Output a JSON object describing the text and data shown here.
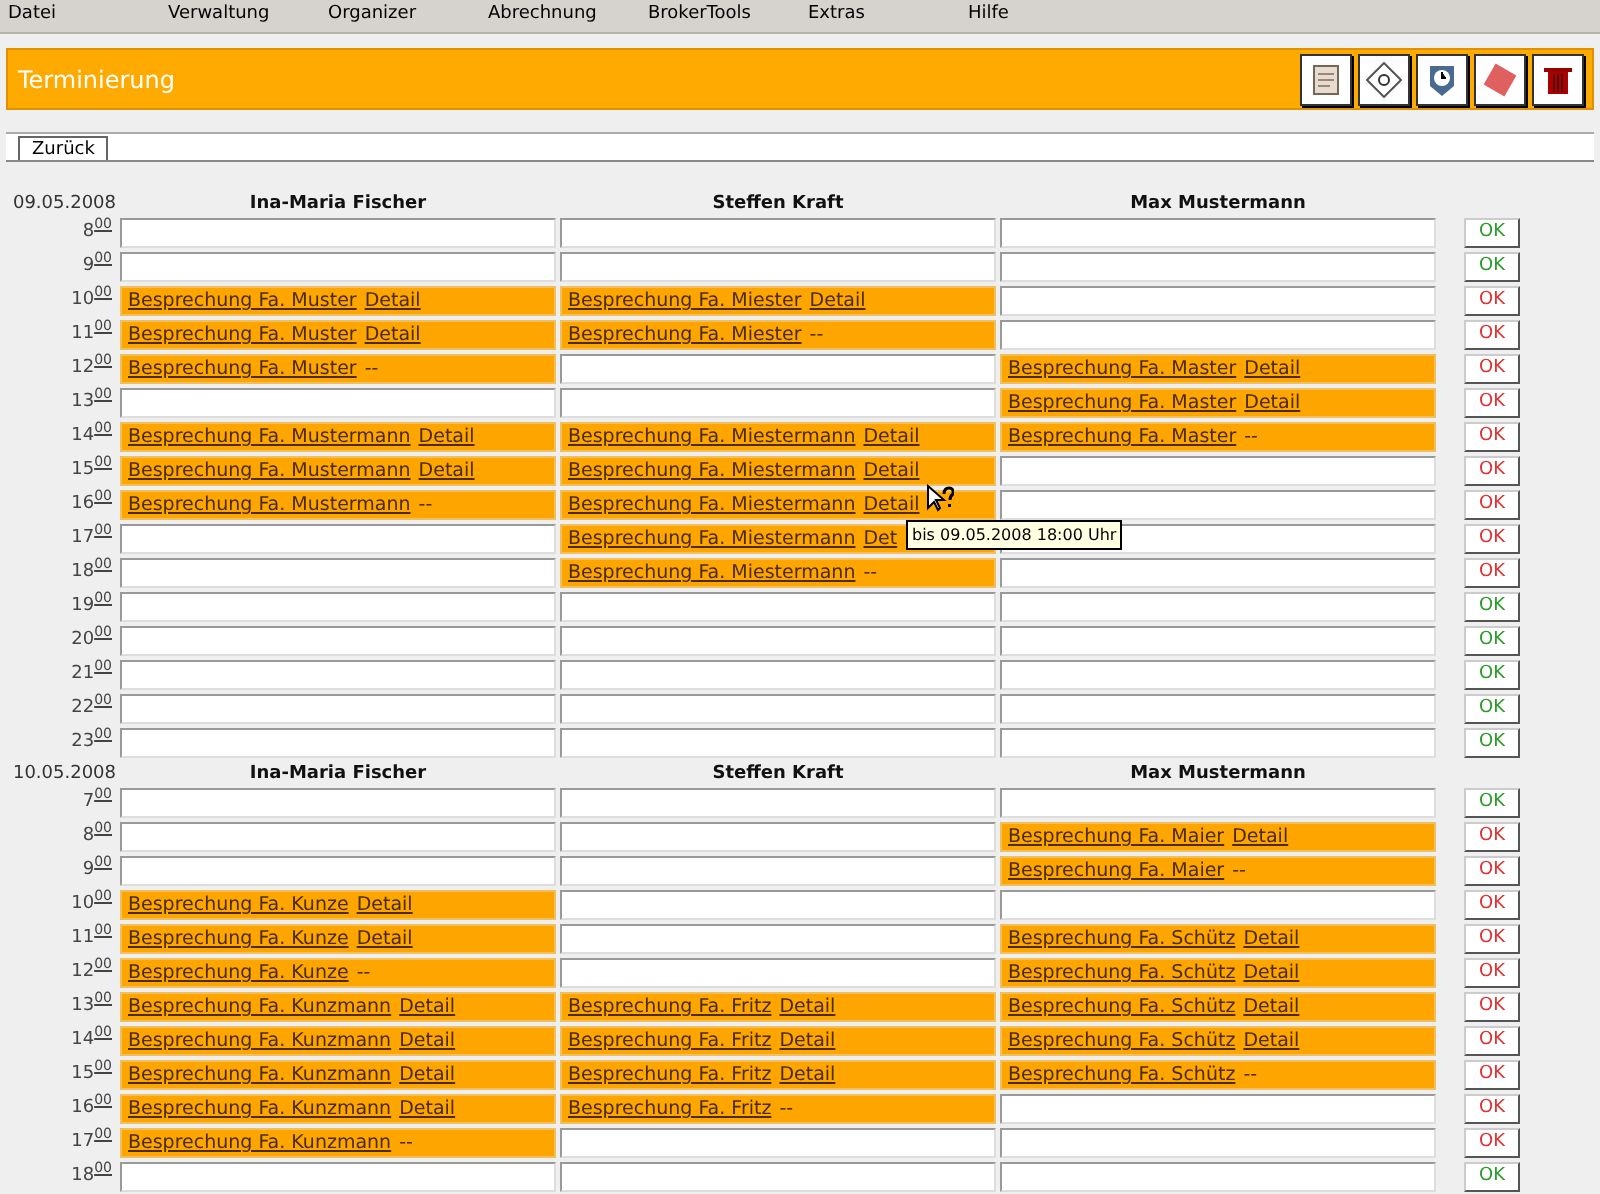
{
  "menu": [
    "Datei",
    "Verwaltung",
    "Organizer",
    "Abrechnung",
    "BrokerTools",
    "Extras",
    "Hilfe"
  ],
  "header": {
    "title": "Terminierung"
  },
  "tabs": [
    {
      "label": "Zurück",
      "selected": true
    }
  ],
  "days": [
    {
      "date": "09.05.2008",
      "people": [
        "Ina-Maria Fischer",
        "Steffen Kraft",
        "Max Mustermann"
      ],
      "rows": [
        {
          "hour": "8$^{00}$",
          "busy": false,
          "button": "OK",
          "slots": [
            {
              "kind": "free"
            },
            {
              "kind": "free"
            },
            {
              "kind": "free"
            }
          ]
        },
        {
          "hour": "9$^{00}$",
          "busy": false,
          "button": "OK",
          "slots": [
            {
              "kind": "free"
            },
            {
              "kind": "free"
            },
            {
              "kind": "free"
            }
          ]
        },
        {
          "hour": "10$^{00}$",
          "busy": true,
          "button": "OK",
          "slots": [
            {
              "kind": "appointment",
              "subject": "Besprechung Fa. Muster",
              "action": "Detail"
            },
            {
              "kind": "appointment",
              "subject": "Besprechung Fa. Miester",
              "action": "Detail"
            },
            {
              "kind": "free"
            }
          ]
        },
        {
          "hour": "11$^{00}$",
          "busy": true,
          "button": "OK",
          "slots": [
            {
              "kind": "appointment",
              "subject": "Besprechung Fa. Muster",
              "action": "Detail"
            },
            {
              "kind": "appointment",
              "subject": "Besprechung Fa. Miester",
              "action": "--"
            },
            {
              "kind": "free"
            }
          ]
        },
        {
          "hour": "12$^{00}$",
          "busy": true,
          "button": "OK",
          "slots": [
            {
              "kind": "appointment",
              "subject": "Besprechung Fa. Muster",
              "action": "--"
            },
            {
              "kind": "free"
            },
            {
              "kind": "appointment",
              "subject": "Besprechung Fa. Master",
              "action": "Detail"
            }
          ]
        },
        {
          "hour": "13$^{00}$",
          "busy": true,
          "button": "OK",
          "slots": [
            {
              "kind": "free"
            },
            {
              "kind": "free"
            },
            {
              "kind": "appointment",
              "subject": "Besprechung Fa. Master",
              "action": "Detail"
            }
          ]
        },
        {
          "hour": "14$^{00}$",
          "busy": true,
          "button": "OK",
          "slots": [
            {
              "kind": "appointment",
              "subject": "Besprechung Fa. Mustermann",
              "action": "Detail"
            },
            {
              "kind": "appointment",
              "subject": "Besprechung Fa. Miestermann",
              "action": "Detail"
            },
            {
              "kind": "appointment",
              "subject": "Besprechung Fa. Master",
              "action": "--"
            }
          ]
        },
        {
          "hour": "15$^{00}$",
          "busy": true,
          "button": "OK",
          "slots": [
            {
              "kind": "appointment",
              "subject": "Besprechung Fa. Mustermann",
              "action": "Detail"
            },
            {
              "kind": "appointment",
              "subject": "Besprechung Fa. Miestermann",
              "action": "Detail"
            },
            {
              "kind": "free"
            }
          ]
        },
        {
          "hour": "16$^{00}$",
          "busy": true,
          "button": "OK",
          "slots": [
            {
              "kind": "appointment",
              "subject": "Besprechung Fa. Mustermann",
              "action": "--"
            },
            {
              "kind": "appointment",
              "subject": "Besprechung Fa. Miestermann",
              "action": "Detail"
            },
            {
              "kind": "free"
            }
          ]
        },
        {
          "hour": "17$^{00}$",
          "busy": true,
          "button": "OK",
          "slots": [
            {
              "kind": "free"
            },
            {
              "kind": "appointment",
              "subject": "Besprechung Fa. Miestermann",
              "action": "Det"
            },
            {
              "kind": "free"
            }
          ]
        },
        {
          "hour": "18$^{00}$",
          "busy": true,
          "button": "OK",
          "slots": [
            {
              "kind": "free"
            },
            {
              "kind": "appointment",
              "subject": "Besprechung Fa. Miestermann",
              "action": "--"
            },
            {
              "kind": "free"
            }
          ]
        },
        {
          "hour": "19$^{00}$",
          "busy": false,
          "button": "OK",
          "slots": [
            {
              "kind": "free"
            },
            {
              "kind": "free"
            },
            {
              "kind": "free"
            }
          ]
        },
        {
          "hour": "20$^{00}$",
          "busy": false,
          "button": "OK",
          "slots": [
            {
              "kind": "free"
            },
            {
              "kind": "free"
            },
            {
              "kind": "free"
            }
          ]
        },
        {
          "hour": "21$^{00}$",
          "busy": false,
          "button": "OK",
          "slots": [
            {
              "kind": "free"
            },
            {
              "kind": "free"
            },
            {
              "kind": "free"
            }
          ]
        },
        {
          "hour": "22$^{00}$",
          "busy": false,
          "button": "OK",
          "slots": [
            {
              "kind": "free"
            },
            {
              "kind": "free"
            },
            {
              "kind": "free"
            }
          ]
        },
        {
          "hour": "23$^{00}$",
          "busy": false,
          "button": "OK",
          "slots": [
            {
              "kind": "free"
            },
            {
              "kind": "free"
            },
            {
              "kind": "free"
            }
          ]
        }
      ]
    },
    {
      "date": "10.05.2008",
      "people": [
        "Ina-Maria Fischer",
        "Steffen Kraft",
        "Max Mustermann"
      ],
      "rows": [
        {
          "hour": "7$^{00}$",
          "busy": false,
          "button": "OK",
          "slots": [
            {
              "kind": "free"
            },
            {
              "kind": "free"
            },
            {
              "kind": "free"
            }
          ]
        },
        {
          "hour": "8$^{00}$",
          "busy": true,
          "button": "OK",
          "slots": [
            {
              "kind": "free"
            },
            {
              "kind": "free"
            },
            {
              "kind": "appointment",
              "subject": "Besprechung Fa. Maier",
              "action": "Detail"
            }
          ]
        },
        {
          "hour": "9$^{00}$",
          "busy": true,
          "button": "OK",
          "slots": [
            {
              "kind": "free"
            },
            {
              "kind": "free"
            },
            {
              "kind": "appointment",
              "subject": "Besprechung Fa. Maier",
              "action": "--"
            }
          ]
        },
        {
          "hour": "10$^{00}$",
          "busy": true,
          "button": "OK",
          "slots": [
            {
              "kind": "appointment",
              "subject": "Besprechung Fa. Kunze",
              "action": "Detail"
            },
            {
              "kind": "free"
            },
            {
              "kind": "free"
            }
          ]
        },
        {
          "hour": "11$^{00}$",
          "busy": true,
          "button": "OK",
          "slots": [
            {
              "kind": "appointment",
              "subject": "Besprechung Fa. Kunze",
              "action": "Detail"
            },
            {
              "kind": "free"
            },
            {
              "kind": "appointment",
              "subject": "Besprechung Fa. Schütz",
              "action": "Detail"
            }
          ]
        },
        {
          "hour": "12$^{00}$",
          "busy": true,
          "button": "OK",
          "slots": [
            {
              "kind": "appointment",
              "subject": "Besprechung Fa. Kunze",
              "action": "--"
            },
            {
              "kind": "free"
            },
            {
              "kind": "appointment",
              "subject": "Besprechung Fa. Schütz",
              "action": "Detail"
            }
          ]
        },
        {
          "hour": "13$^{00}$",
          "busy": true,
          "button": "OK",
          "slots": [
            {
              "kind": "appointment",
              "subject": "Besprechung Fa. Kunzmann",
              "action": "Detail"
            },
            {
              "kind": "appointment",
              "subject": "Besprechung Fa. Fritz",
              "action": "Detail"
            },
            {
              "kind": "appointment",
              "subject": "Besprechung Fa. Schütz",
              "action": "Detail"
            }
          ]
        },
        {
          "hour": "14$^{00}$",
          "busy": true,
          "button": "OK",
          "slots": [
            {
              "kind": "appointment",
              "subject": "Besprechung Fa. Kunzmann",
              "action": "Detail"
            },
            {
              "kind": "appointment",
              "subject": "Besprechung Fa. Fritz",
              "action": "Detail"
            },
            {
              "kind": "appointment",
              "subject": "Besprechung Fa. Schütz",
              "action": "Detail"
            }
          ]
        },
        {
          "hour": "15$^{00}$",
          "busy": true,
          "button": "OK",
          "slots": [
            {
              "kind": "appointment",
              "subject": "Besprechung Fa. Kunzmann",
              "action": "Detail"
            },
            {
              "kind": "appointment",
              "subject": "Besprechung Fa. Fritz",
              "action": "Detail"
            },
            {
              "kind": "appointment",
              "subject": "Besprechung Fa. Schütz",
              "action": "--"
            }
          ]
        },
        {
          "hour": "16$^{00}$",
          "busy": true,
          "button": "OK",
          "slots": [
            {
              "kind": "appointment",
              "subject": "Besprechung Fa. Kunzmann",
              "action": "Detail"
            },
            {
              "kind": "appointment",
              "subject": "Besprechung Fa. Fritz",
              "action": "--"
            },
            {
              "kind": "free"
            }
          ]
        },
        {
          "hour": "17$^{00}$",
          "busy": true,
          "button": "OK",
          "slots": [
            {
              "kind": "appointment",
              "subject": "Besprechung Fa. Kunzmann",
              "action": "--"
            },
            {
              "kind": "free"
            },
            {
              "kind": "free"
            }
          ]
        },
        {
          "hour": "18$^{00}$",
          "busy": false,
          "button": "OK",
          "slots": [
            {
              "kind": "free"
            },
            {
              "kind": "free"
            },
            {
              "kind": "free"
            }
          ]
        }
      ]
    }
  ],
  "tooltip": {
    "text": "bis 09.05.2008 18:00 Uhr"
  }
}
